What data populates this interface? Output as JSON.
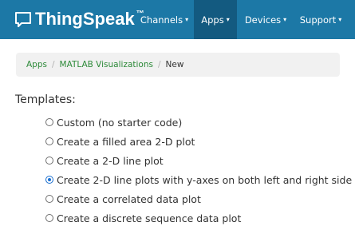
{
  "navbar": {
    "brand_text": "ThingSpeak",
    "brand_tm": "™",
    "items": [
      {
        "label": "Channels",
        "caret": "▾"
      },
      {
        "label": "Apps",
        "caret": "▾"
      },
      {
        "label": "Devices",
        "caret": "▾"
      },
      {
        "label": "Support",
        "caret": "▾"
      }
    ],
    "active_item": "Apps",
    "colors": {
      "background": "#1c78a6",
      "active": "#135a80"
    }
  },
  "breadcrumb": {
    "items": [
      "Apps",
      "MATLAB Visualizations"
    ],
    "separator": "/",
    "current": "New"
  },
  "templates": {
    "heading": "Templates:",
    "options": [
      {
        "label": "Custom (no starter code)",
        "checked": false
      },
      {
        "label": "Create a filled area 2-D plot",
        "checked": false
      },
      {
        "label": "Create a 2-D line plot",
        "checked": false
      },
      {
        "label": "Create 2-D line plots with y-axes on both left and right side",
        "checked": true
      },
      {
        "label": "Create a correlated data plot",
        "checked": false
      },
      {
        "label": "Create a discrete sequence data plot",
        "checked": false
      }
    ]
  }
}
